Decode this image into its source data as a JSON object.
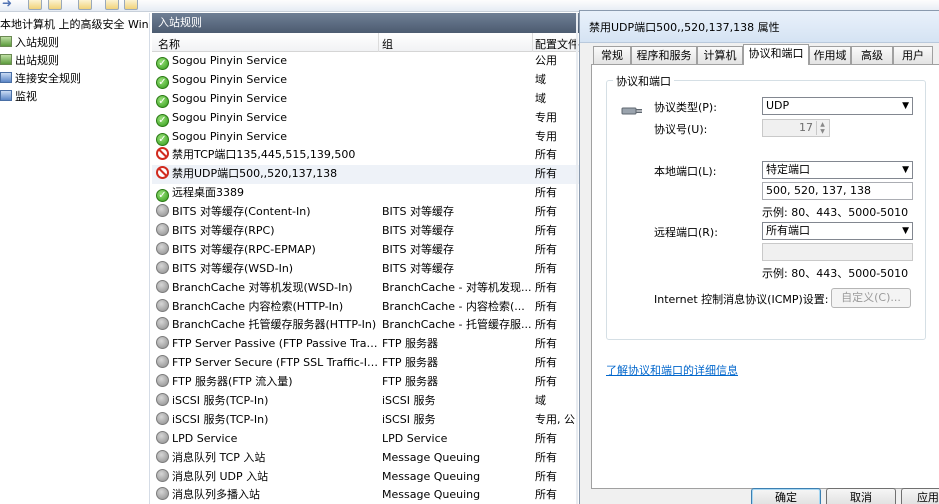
{
  "tree": {
    "root_label": "本地计算机 上的高级安全 Windows 防火墙",
    "items": [
      {
        "label": "入站规则"
      },
      {
        "label": "出站规则"
      },
      {
        "label": "连接安全规则"
      },
      {
        "label": "监视"
      }
    ]
  },
  "list": {
    "title": "入站规则",
    "columns": {
      "name": "名称",
      "group": "组",
      "profile": "配置文件"
    },
    "rows": [
      {
        "status": "ok",
        "name": "Sogou Pinyin Service",
        "group": "",
        "profile": "公用"
      },
      {
        "status": "ok",
        "name": "Sogou Pinyin Service",
        "group": "",
        "profile": "域"
      },
      {
        "status": "ok",
        "name": "Sogou Pinyin Service",
        "group": "",
        "profile": "域"
      },
      {
        "status": "ok",
        "name": "Sogou Pinyin Service",
        "group": "",
        "profile": "专用"
      },
      {
        "status": "ok",
        "name": "Sogou Pinyin Service",
        "group": "",
        "profile": "专用"
      },
      {
        "status": "block",
        "name": "禁用TCP端口135,445,515,139,500",
        "group": "",
        "profile": "所有"
      },
      {
        "status": "block",
        "name": "禁用UDP端口500,,520,137,138",
        "group": "",
        "profile": "所有"
      },
      {
        "status": "ok",
        "name": "远程桌面3389",
        "group": "",
        "profile": "所有"
      },
      {
        "status": "off",
        "name": "BITS 对等缓存(Content-In)",
        "group": "BITS 对等缓存",
        "profile": "所有"
      },
      {
        "status": "off",
        "name": "BITS 对等缓存(RPC)",
        "group": "BITS 对等缓存",
        "profile": "所有"
      },
      {
        "status": "off",
        "name": "BITS 对等缓存(RPC-EPMAP)",
        "group": "BITS 对等缓存",
        "profile": "所有"
      },
      {
        "status": "off",
        "name": "BITS 对等缓存(WSD-In)",
        "group": "BITS 对等缓存",
        "profile": "所有"
      },
      {
        "status": "off",
        "name": "BranchCache 对等机发现(WSD-In)",
        "group": "BranchCache - 对等机发现...",
        "profile": "所有"
      },
      {
        "status": "off",
        "name": "BranchCache 内容检索(HTTP-In)",
        "group": "BranchCache - 内容检索(...",
        "profile": "所有"
      },
      {
        "status": "off",
        "name": "BranchCache 托管缓存服务器(HTTP-In)",
        "group": "BranchCache - 托管缓存服...",
        "profile": "所有"
      },
      {
        "status": "off",
        "name": "FTP Server Passive (FTP Passive Traffi...",
        "group": "FTP 服务器",
        "profile": "所有"
      },
      {
        "status": "off",
        "name": "FTP Server Secure (FTP SSL Traffic-In)",
        "group": "FTP 服务器",
        "profile": "所有"
      },
      {
        "status": "off",
        "name": "FTP 服务器(FTP 流入量)",
        "group": "FTP 服务器",
        "profile": "所有"
      },
      {
        "status": "off",
        "name": "iSCSI 服务(TCP-In)",
        "group": "iSCSI 服务",
        "profile": "域"
      },
      {
        "status": "off",
        "name": "iSCSI 服务(TCP-In)",
        "group": "iSCSI 服务",
        "profile": "专用, 公"
      },
      {
        "status": "off",
        "name": "LPD Service",
        "group": "LPD Service",
        "profile": "所有"
      },
      {
        "status": "off",
        "name": "消息队列 TCP 入站",
        "group": "Message Queuing",
        "profile": "所有"
      },
      {
        "status": "off",
        "name": "消息队列 UDP 入站",
        "group": "Message Queuing",
        "profile": "所有"
      },
      {
        "status": "off",
        "name": "消息队列多播入站",
        "group": "Message Queuing",
        "profile": "所有"
      }
    ]
  },
  "dialog": {
    "title": "禁用UDP端口500,,520,137,138 属性",
    "tabs": [
      "常规",
      "程序和服务",
      "计算机",
      "协议和端口",
      "作用域",
      "高级",
      "用户"
    ],
    "group_label": "协议和端口",
    "protocol_type_label": "协议类型(P):",
    "protocol_type_value": "UDP",
    "protocol_number_label": "协议号(U):",
    "protocol_number_value": "17",
    "local_port_label": "本地端口(L):",
    "local_port_mode": "特定端口",
    "local_port_value": "500, 520, 137, 138",
    "example_text": "示例: 80、443、5000-5010",
    "remote_port_label": "远程端口(R):",
    "remote_port_mode": "所有端口",
    "remote_port_value": "",
    "icmp_label": "Internet 控制消息协议(ICMP)设置:",
    "customize_button": "自定义(C)...",
    "learn_more_link": "了解协议和端口的详细信息",
    "ok_button": "确定",
    "cancel_button": "取消",
    "apply_button": "应用(A)"
  }
}
